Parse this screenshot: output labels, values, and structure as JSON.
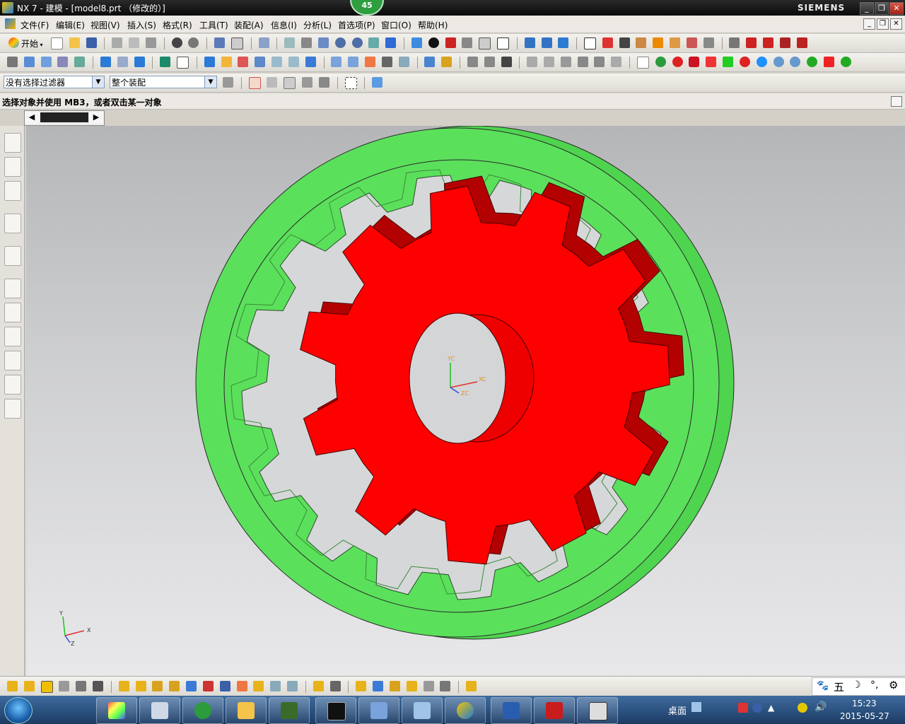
{
  "window": {
    "title": "NX 7 - 建模 - [model8.prt （修改的）]",
    "brand": "SIEMENS",
    "notification_badge": "45"
  },
  "menu": {
    "items": [
      "文件(F)",
      "编辑(E)",
      "视图(V)",
      "插入(S)",
      "格式(R)",
      "工具(T)",
      "装配(A)",
      "信息(I)",
      "分析(L)",
      "首选项(P)",
      "窗口(O)",
      "帮助(H)"
    ]
  },
  "toolbar": {
    "start_label": "开始",
    "selection_filter": "没有选择过滤器",
    "selection_scope": "整个装配"
  },
  "cue_line": {
    "text": "选择对象并使用 MB3，或者双击某一对象"
  },
  "graphics": {
    "csys_center": {
      "x": "XC",
      "y": "YC",
      "z": "ZC"
    },
    "csys_corner": {
      "x": "X",
      "y": "Y",
      "z": "Z"
    },
    "internal_gear_color": "#55e055",
    "pinion_color": "#ff0000",
    "background_top": "#b5b6b8",
    "background_bottom": "#e8e8ea"
  },
  "taskbar": {
    "desktop_label": "桌面",
    "time": "15:23",
    "date": "2015-05-27",
    "apps": [
      "paint-icon",
      "calculator-icon",
      "ie-icon",
      "explorer-icon",
      "keyboard-icon",
      "cmd-icon",
      "remote-desktop-icon",
      "generic-icon",
      "nx-icon",
      "word-icon",
      "acrobat-icon",
      "ggg-icon"
    ]
  },
  "ime": {
    "char": "五"
  }
}
